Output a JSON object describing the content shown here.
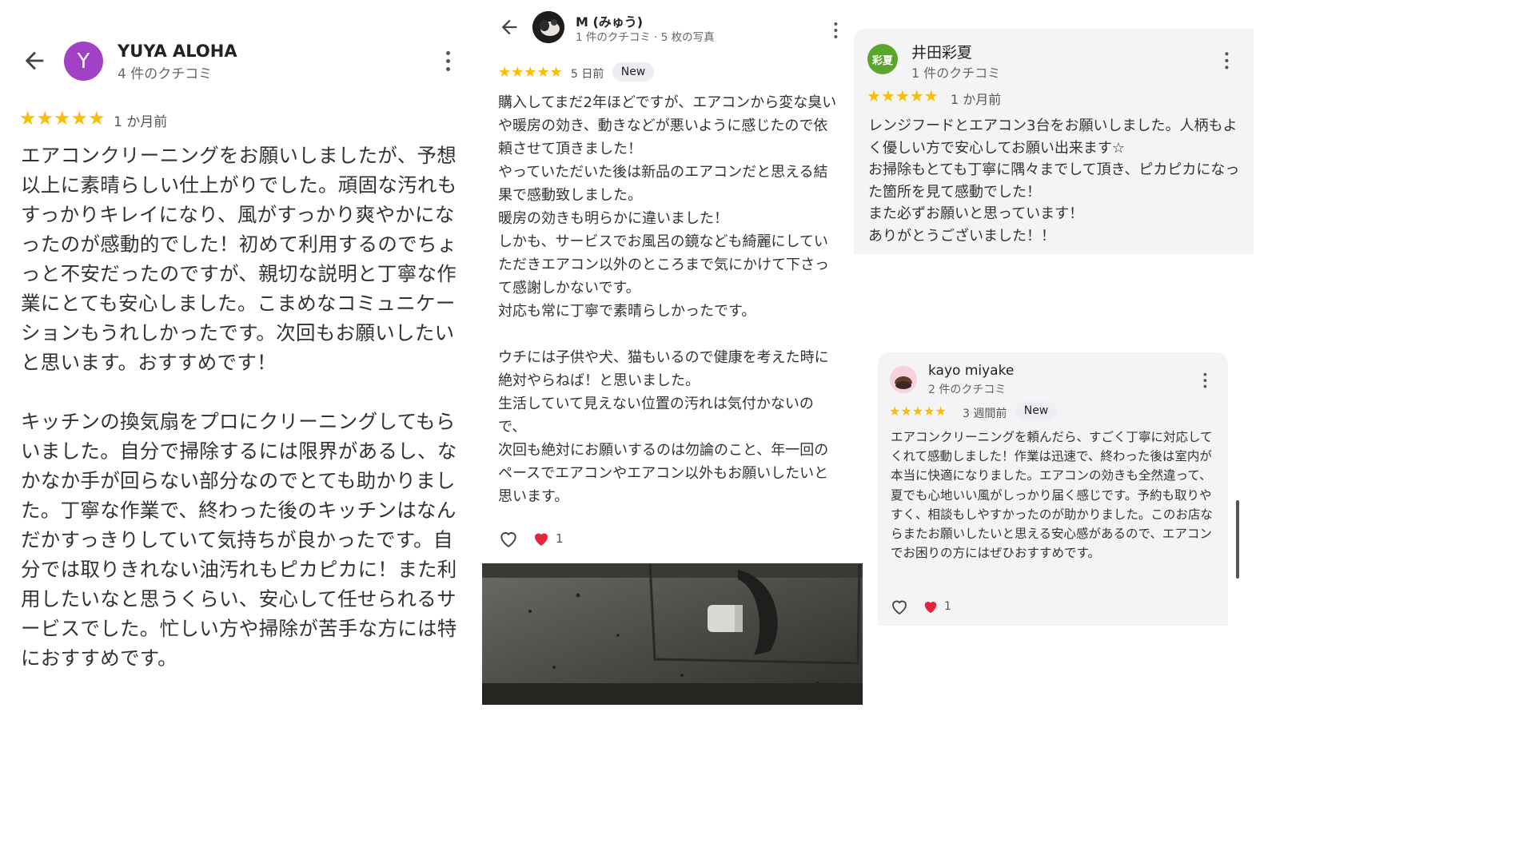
{
  "review1": {
    "avatar_letter": "Y",
    "name": "YUYA ALOHA",
    "count": "4 件のクチコミ",
    "stars": "★★★★★",
    "time": "1 か月前",
    "text": "エアコンクリーニングをお願いしましたが、予想以上に素晴らしい仕上がりでした。頑固な汚れもすっかりキレイになり、風がすっかり爽やかになったのが感動的でした！初めて利用するのでちょっと不安だったのですが、親切な説明と丁寧な作業にとても安心しました。こまめなコミュニケーションもうれしかったです。次回もお願いしたいと思います。おすすめです！\n\nキッチンの換気扇をプロにクリーニングしてもらいました。自分で掃除するには限界があるし、なかなか手が回らない部分なのでとても助かりました。丁寧な作業で、終わった後のキッチンはなんだかすっきりしていて気持ちが良かったです。自分では取りきれない油汚れもピカピカに！また利用したいなと思うくらい、安心して任せられるサービスでした。忙しい方や掃除が苦手な方には特におすすめです。"
  },
  "review2": {
    "name": "M (みゅう)",
    "count": "1 件のクチコミ · 5 枚の写真",
    "stars": "★★★★★",
    "time": "5 日前",
    "badge": "New",
    "text": "購入してまだ2年ほどですが、エアコンから変な臭いや暖房の効き、動きなどが悪いように感じたので依頼させて頂きました！\nやっていただいた後は新品のエアコンだと思える結果で感動致しました。\n暖房の効きも明らかに違いました！\nしかも、サービスでお風呂の鏡なども綺麗にしていただきエアコン以外のところまで気にかけて下さって感謝しかないです。\n対応も常に丁寧で素晴らしかったです。\n\nウチには子供や犬、猫もいるので健康を考えた時に絶対やらねば！と思いました。\n生活していて見えない位置の汚れは気付かないので、\n次回も絶対にお願いするのは勿論のこと、年一回のペースでエアコンやエアコン以外もお願いしたいと思います。",
    "likes": "1"
  },
  "review3": {
    "avatar_text": "彩夏",
    "name": "井田彩夏",
    "count": "1 件のクチコミ",
    "stars": "★★★★★",
    "time": "1 か月前",
    "text": "レンジフードとエアコン3台をお願いしました。人柄もよく優しい方で安心してお願い出来ます☆\nお掃除もとても丁寧に隅々までして頂き、ピカピカになった箇所を見て感動でした！\nまた必ずお願いと思っています！\nありがとうございました！！"
  },
  "review4": {
    "name": "kayo miyake",
    "count": "2 件のクチコミ",
    "stars": "★★★★★",
    "time": "3 週間前",
    "badge": "New",
    "text": "エアコンクリーニングを頼んだら、すごく丁寧に対応してくれて感動しました！作業は迅速で、終わった後は室内が本当に快適になりました。エアコンの効きも全然違って、夏でも心地いい風がしっかり届く感じです。予約も取りやすく、相談もしやすかったのが助かりました。このお店ならまたお願いしたいと思える安心感があるので、エアコンでお困りの方にはぜひおすすめです。",
    "likes": "1"
  },
  "colors": {
    "star": "#fbbc04",
    "avatar_purple": "#a142c6",
    "avatar_green": "#5aa52e",
    "heart_red": "#e8243c"
  }
}
